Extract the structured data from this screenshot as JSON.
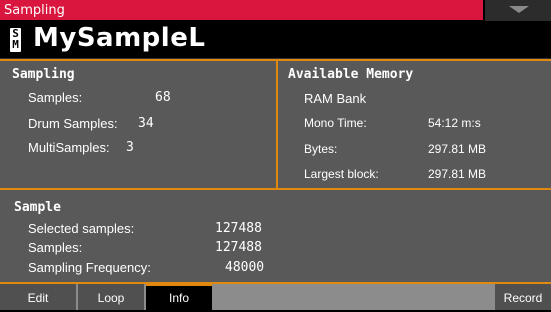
{
  "title_bar": {
    "title": "Sampling"
  },
  "sample": {
    "badge_top": "S",
    "badge_bottom": "M",
    "name": "MySampleL"
  },
  "sampling": {
    "heading": "Sampling",
    "samples_label": "Samples:",
    "samples_value": "68",
    "drum_label": "Drum Samples:",
    "drum_value": "34",
    "multi_label": "MultiSamples:",
    "multi_value": "3"
  },
  "memory": {
    "heading": "Available Memory",
    "bank": "RAM Bank",
    "mono_label": "Mono Time:",
    "mono_value": "54:12 m:s",
    "bytes_label": "Bytes:",
    "bytes_value": "297.81 MB",
    "largest_label": "Largest block:",
    "largest_value": "297.81 MB"
  },
  "sample_info": {
    "heading": "Sample",
    "selected_label": "Selected samples:",
    "selected_value": "127488",
    "samples_label": "Samples:",
    "samples_value": "127488",
    "freq_label": "Sampling Frequency:",
    "freq_value": "48000"
  },
  "tabs": [
    {
      "label": "Edit"
    },
    {
      "label": "Loop"
    },
    {
      "label": "Info",
      "active": true
    },
    {
      "label": "Record"
    }
  ],
  "colors": {
    "title_bar": "#d8163e",
    "accent": "#e0890e",
    "panel": "#595959"
  },
  "icons": {
    "menu": "chevron-down-icon"
  }
}
